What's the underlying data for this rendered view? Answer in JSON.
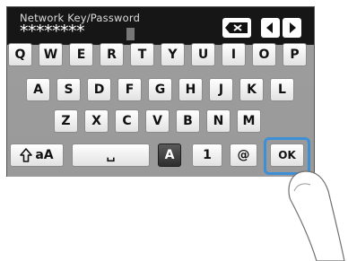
{
  "header": {
    "title": "Network Key/Password",
    "password_mask": "********"
  },
  "keyboard": {
    "row1": [
      "Q",
      "W",
      "E",
      "R",
      "T",
      "Y",
      "U",
      "I",
      "O",
      "P"
    ],
    "row2": [
      "A",
      "S",
      "D",
      "F",
      "G",
      "H",
      "J",
      "K",
      "L"
    ],
    "row3": [
      "Z",
      "X",
      "C",
      "V",
      "B",
      "N",
      "M"
    ],
    "shift_label": "aA",
    "space_label": "␣",
    "mode_alpha": "A",
    "mode_number": "1",
    "mode_symbol": "@",
    "ok_label": "OK"
  },
  "icons": {
    "backspace": "backspace-icon",
    "left": "arrow-left-icon",
    "right": "arrow-right-icon",
    "shift": "shift-icon",
    "finger": "pointing-finger"
  }
}
